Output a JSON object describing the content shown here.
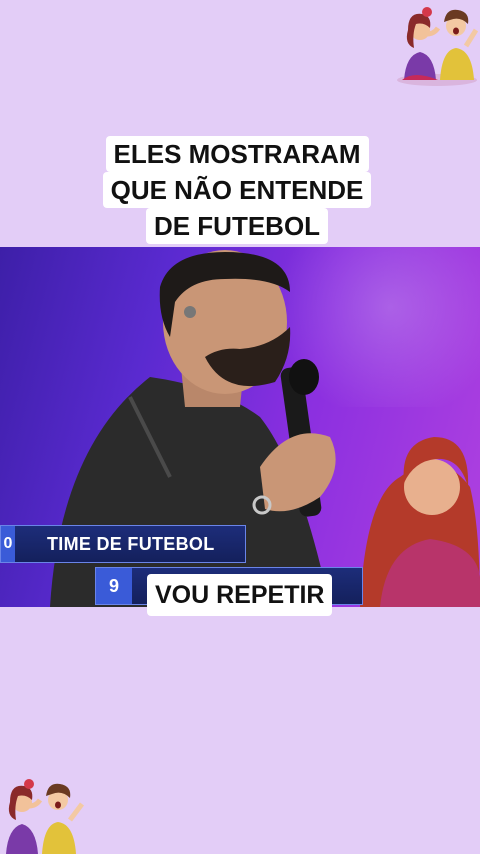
{
  "caption_top": {
    "lines": [
      "ELES MOSTRARAM",
      "QUE NÃO ENTENDE",
      "DE FUTEBOL"
    ]
  },
  "scoreboard": {
    "row1": {
      "number": "0",
      "text": "TIME DE FUTEBOL"
    },
    "row2": {
      "number": "9"
    }
  },
  "caption_bottom": {
    "text": "VOU REPETIR"
  },
  "colors": {
    "background": "#e3cdf7",
    "stage": "#7a2fd8",
    "scoreboard": "#1d2d7a"
  },
  "icons": {
    "top_sticker": "gossip-women-sticker-icon",
    "bottom_sticker": "gossip-women-sticker-icon"
  }
}
